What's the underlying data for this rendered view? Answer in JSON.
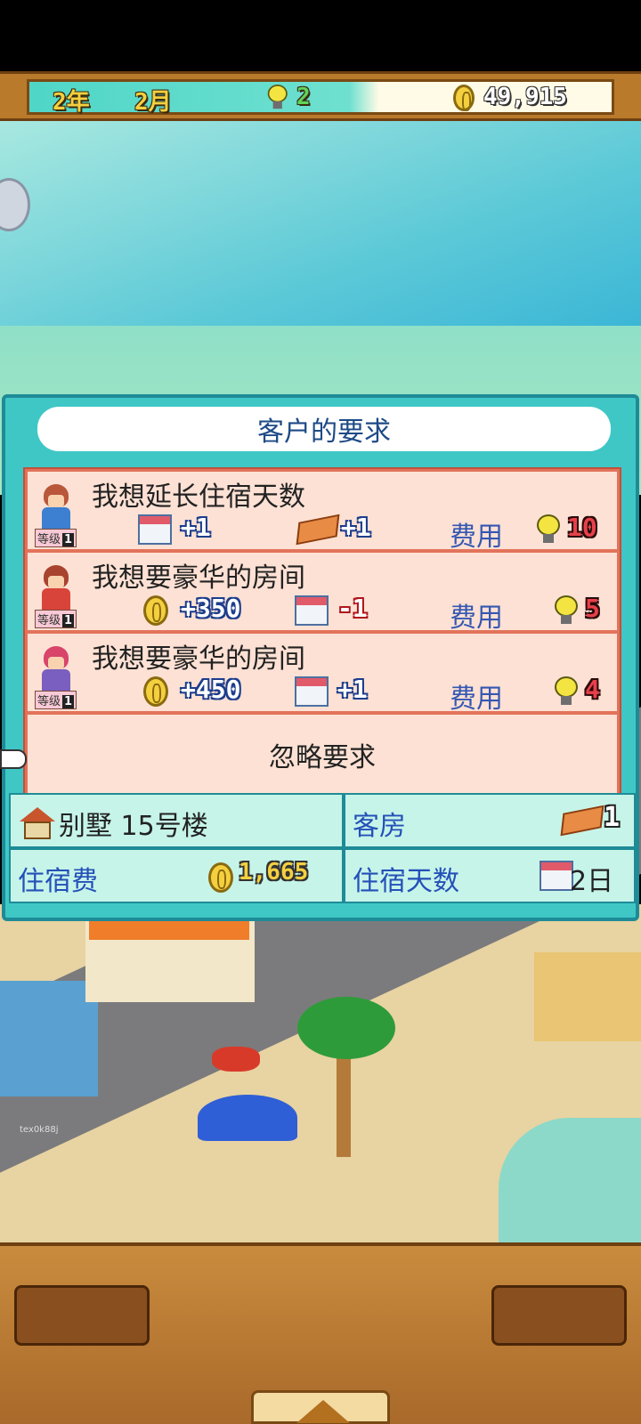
{
  "status_bar": {
    "year": "2年",
    "month": "2月",
    "research_points": "2",
    "money": "49,915"
  },
  "dialog": {
    "title": "客户的要求",
    "requests": [
      {
        "title": "我想延长住宿天数",
        "effect1": "+1",
        "effect2": "+1",
        "cost_label": "费用",
        "cost": "10"
      },
      {
        "title": "我想要豪华的房间",
        "effect1": "+350",
        "effect2": "-1",
        "cost_label": "费用",
        "cost": "5"
      },
      {
        "title": "我想要豪华的房间",
        "effect1": "+450",
        "effect2": "+1",
        "cost_label": "费用",
        "cost": "4"
      }
    ],
    "ignore_label": "忽略要求",
    "level_label": "等级",
    "level_value": "1"
  },
  "info": {
    "building": "别墅 15号楼",
    "room_label": "客房",
    "room_count": "1",
    "fee_label": "住宿费",
    "fee_value": "1,665",
    "days_label": "住宿天数",
    "days_value": "2日"
  },
  "watermark": "tex0k88j",
  "icons": [
    "calendar-icon",
    "brick-icon",
    "coin-icon",
    "lightbulb-icon",
    "house-icon",
    "hand-pointer-icon",
    "chat-icon"
  ],
  "colors": {
    "accent_teal": "#3fc7c6",
    "request_bg": "#fde1d4",
    "cost_text": "#3457b2"
  }
}
